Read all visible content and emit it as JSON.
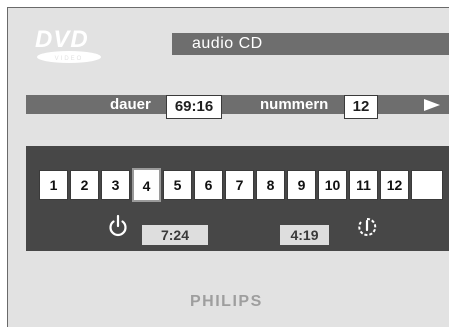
{
  "screen": {
    "logo_text": "DVD",
    "logo_subtext": "VIDEO",
    "title": "audio CD"
  },
  "info": {
    "duration_label": "dauer",
    "duration_value": "69:16",
    "tracks_label": "nummern",
    "tracks_value": "12",
    "play_icon": "play-triangle-icon"
  },
  "tracks": {
    "cells": [
      "1",
      "2",
      "3",
      "4",
      "5",
      "6",
      "7",
      "8",
      "9",
      "10",
      "11",
      "12",
      ""
    ],
    "selected": "4"
  },
  "times": {
    "power_icon": "power-icon",
    "left_time": "7:24",
    "right_time": "4:19",
    "repeat_icon": "repeat-icon"
  },
  "brand": "PHILIPS",
  "colors": {
    "screen_background": "#e2e2e2",
    "bar_gray": "#6e6e6e",
    "panel_dark": "#474747",
    "brand_gray": "#9e9e9e"
  }
}
